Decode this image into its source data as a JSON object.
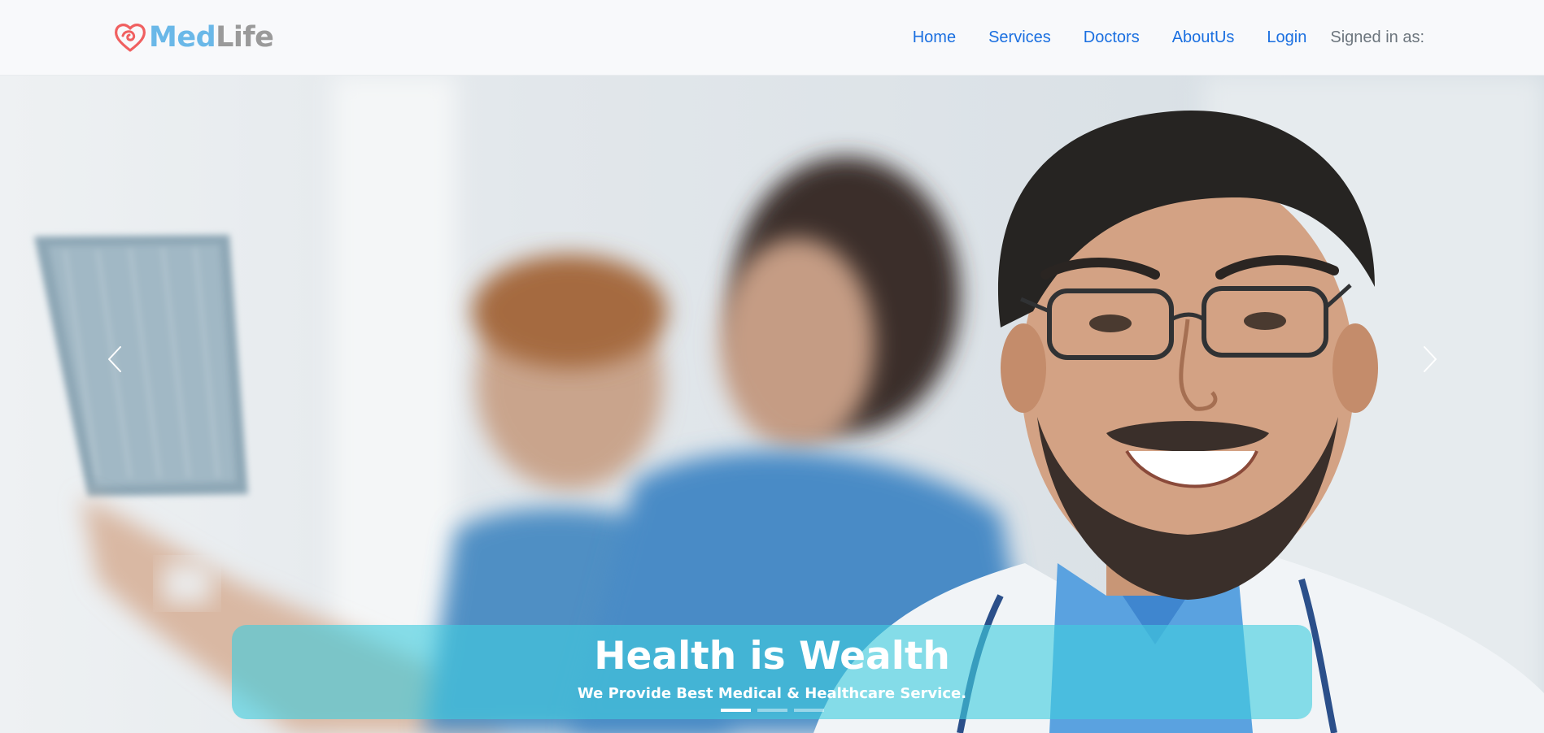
{
  "brand": {
    "part1": "Med",
    "part2": "Life",
    "logo_icon": "heart-pulse-icon",
    "color_primary": "#6ab8e8",
    "color_secondary": "#9a9a9a",
    "logo_color": "#f06060"
  },
  "nav": {
    "items": [
      {
        "label": "Home"
      },
      {
        "label": "Services"
      },
      {
        "label": "Doctors"
      },
      {
        "label": "AboutUs"
      },
      {
        "label": "Login"
      }
    ],
    "signed_in_text": "Signed in as:",
    "link_color": "#1a6fe0"
  },
  "carousel": {
    "prev_icon": "chevron-left-icon",
    "next_icon": "chevron-right-icon",
    "caption": {
      "title": "Health is Wealth",
      "subtitle": "We Provide Best Medical & Healthcare Service."
    },
    "slide_count": 3,
    "active_slide": 1,
    "caption_color": "#40cdde"
  }
}
